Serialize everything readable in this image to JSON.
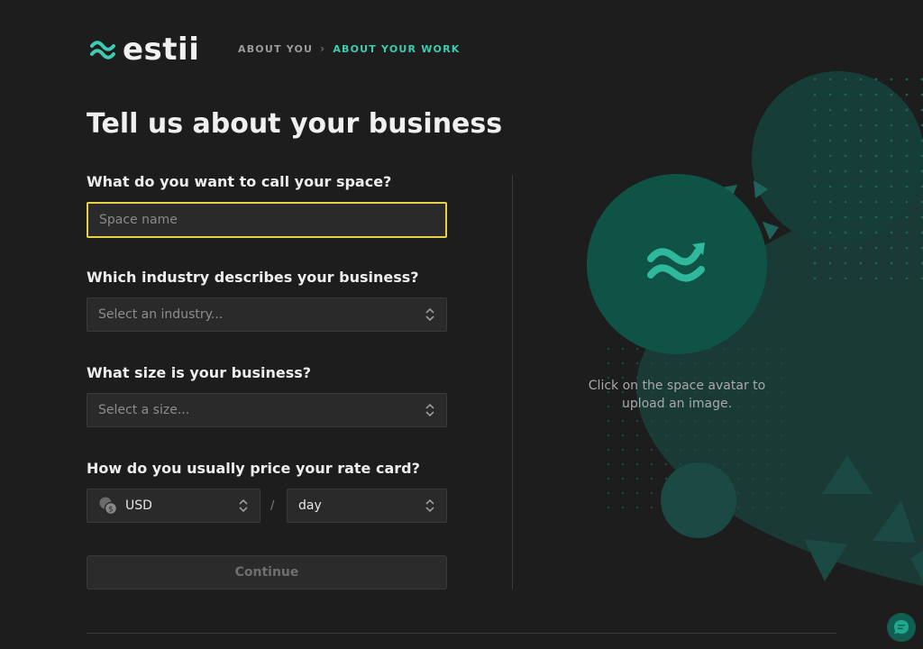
{
  "app": {
    "logo_text": "estii"
  },
  "breadcrumb": {
    "items": [
      {
        "label": "ABOUT YOU",
        "active": false
      },
      {
        "label": "ABOUT YOUR WORK",
        "active": true
      }
    ]
  },
  "page": {
    "title": "Tell us about your business"
  },
  "form": {
    "space_name": {
      "label": "What do you want to call your space?",
      "value": "",
      "placeholder": "Space name"
    },
    "industry": {
      "label": "Which industry describes your business?",
      "value": "Select an industry..."
    },
    "size": {
      "label": "What size is your business?",
      "value": "Select a size..."
    },
    "pricing": {
      "label": "How do you usually price your rate card?",
      "currency": "USD",
      "separator": "/",
      "unit": "day"
    },
    "continue_label": "Continue"
  },
  "avatar": {
    "hint": "Click on the space avatar to upload an image.",
    "icon": "estii-wave-icon"
  },
  "icons": {
    "updown": "chevron-updown-icon",
    "currency": "currency-coins-icon",
    "chat": "chat-icon"
  },
  "colors": {
    "background": "#1d1d1d",
    "accent": "#3ecbb0",
    "avatar": "#0f5347",
    "focus_border": "#e6d04a"
  }
}
